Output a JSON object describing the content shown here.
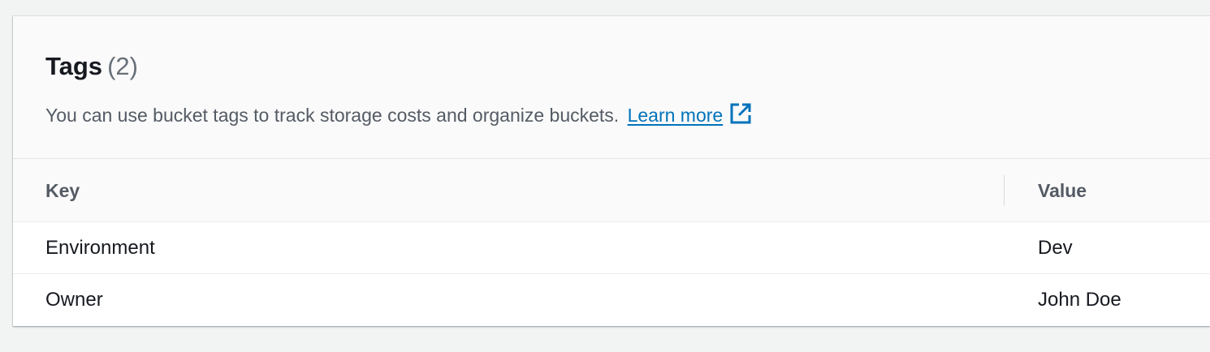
{
  "panel": {
    "title": "Tags",
    "count": "(2)",
    "description": "You can use bucket tags to track storage costs and organize buckets.",
    "learn_more": "Learn more",
    "learn_more_icon": "external-link-icon"
  },
  "table": {
    "columns": [
      "Key",
      "Value"
    ],
    "rows": [
      {
        "key": "Environment",
        "value": "Dev"
      },
      {
        "key": "Owner",
        "value": "John Doe"
      }
    ]
  },
  "colors": {
    "link": "#0073bb",
    "heading": "#16191f",
    "secondary_text": "#545b64"
  }
}
